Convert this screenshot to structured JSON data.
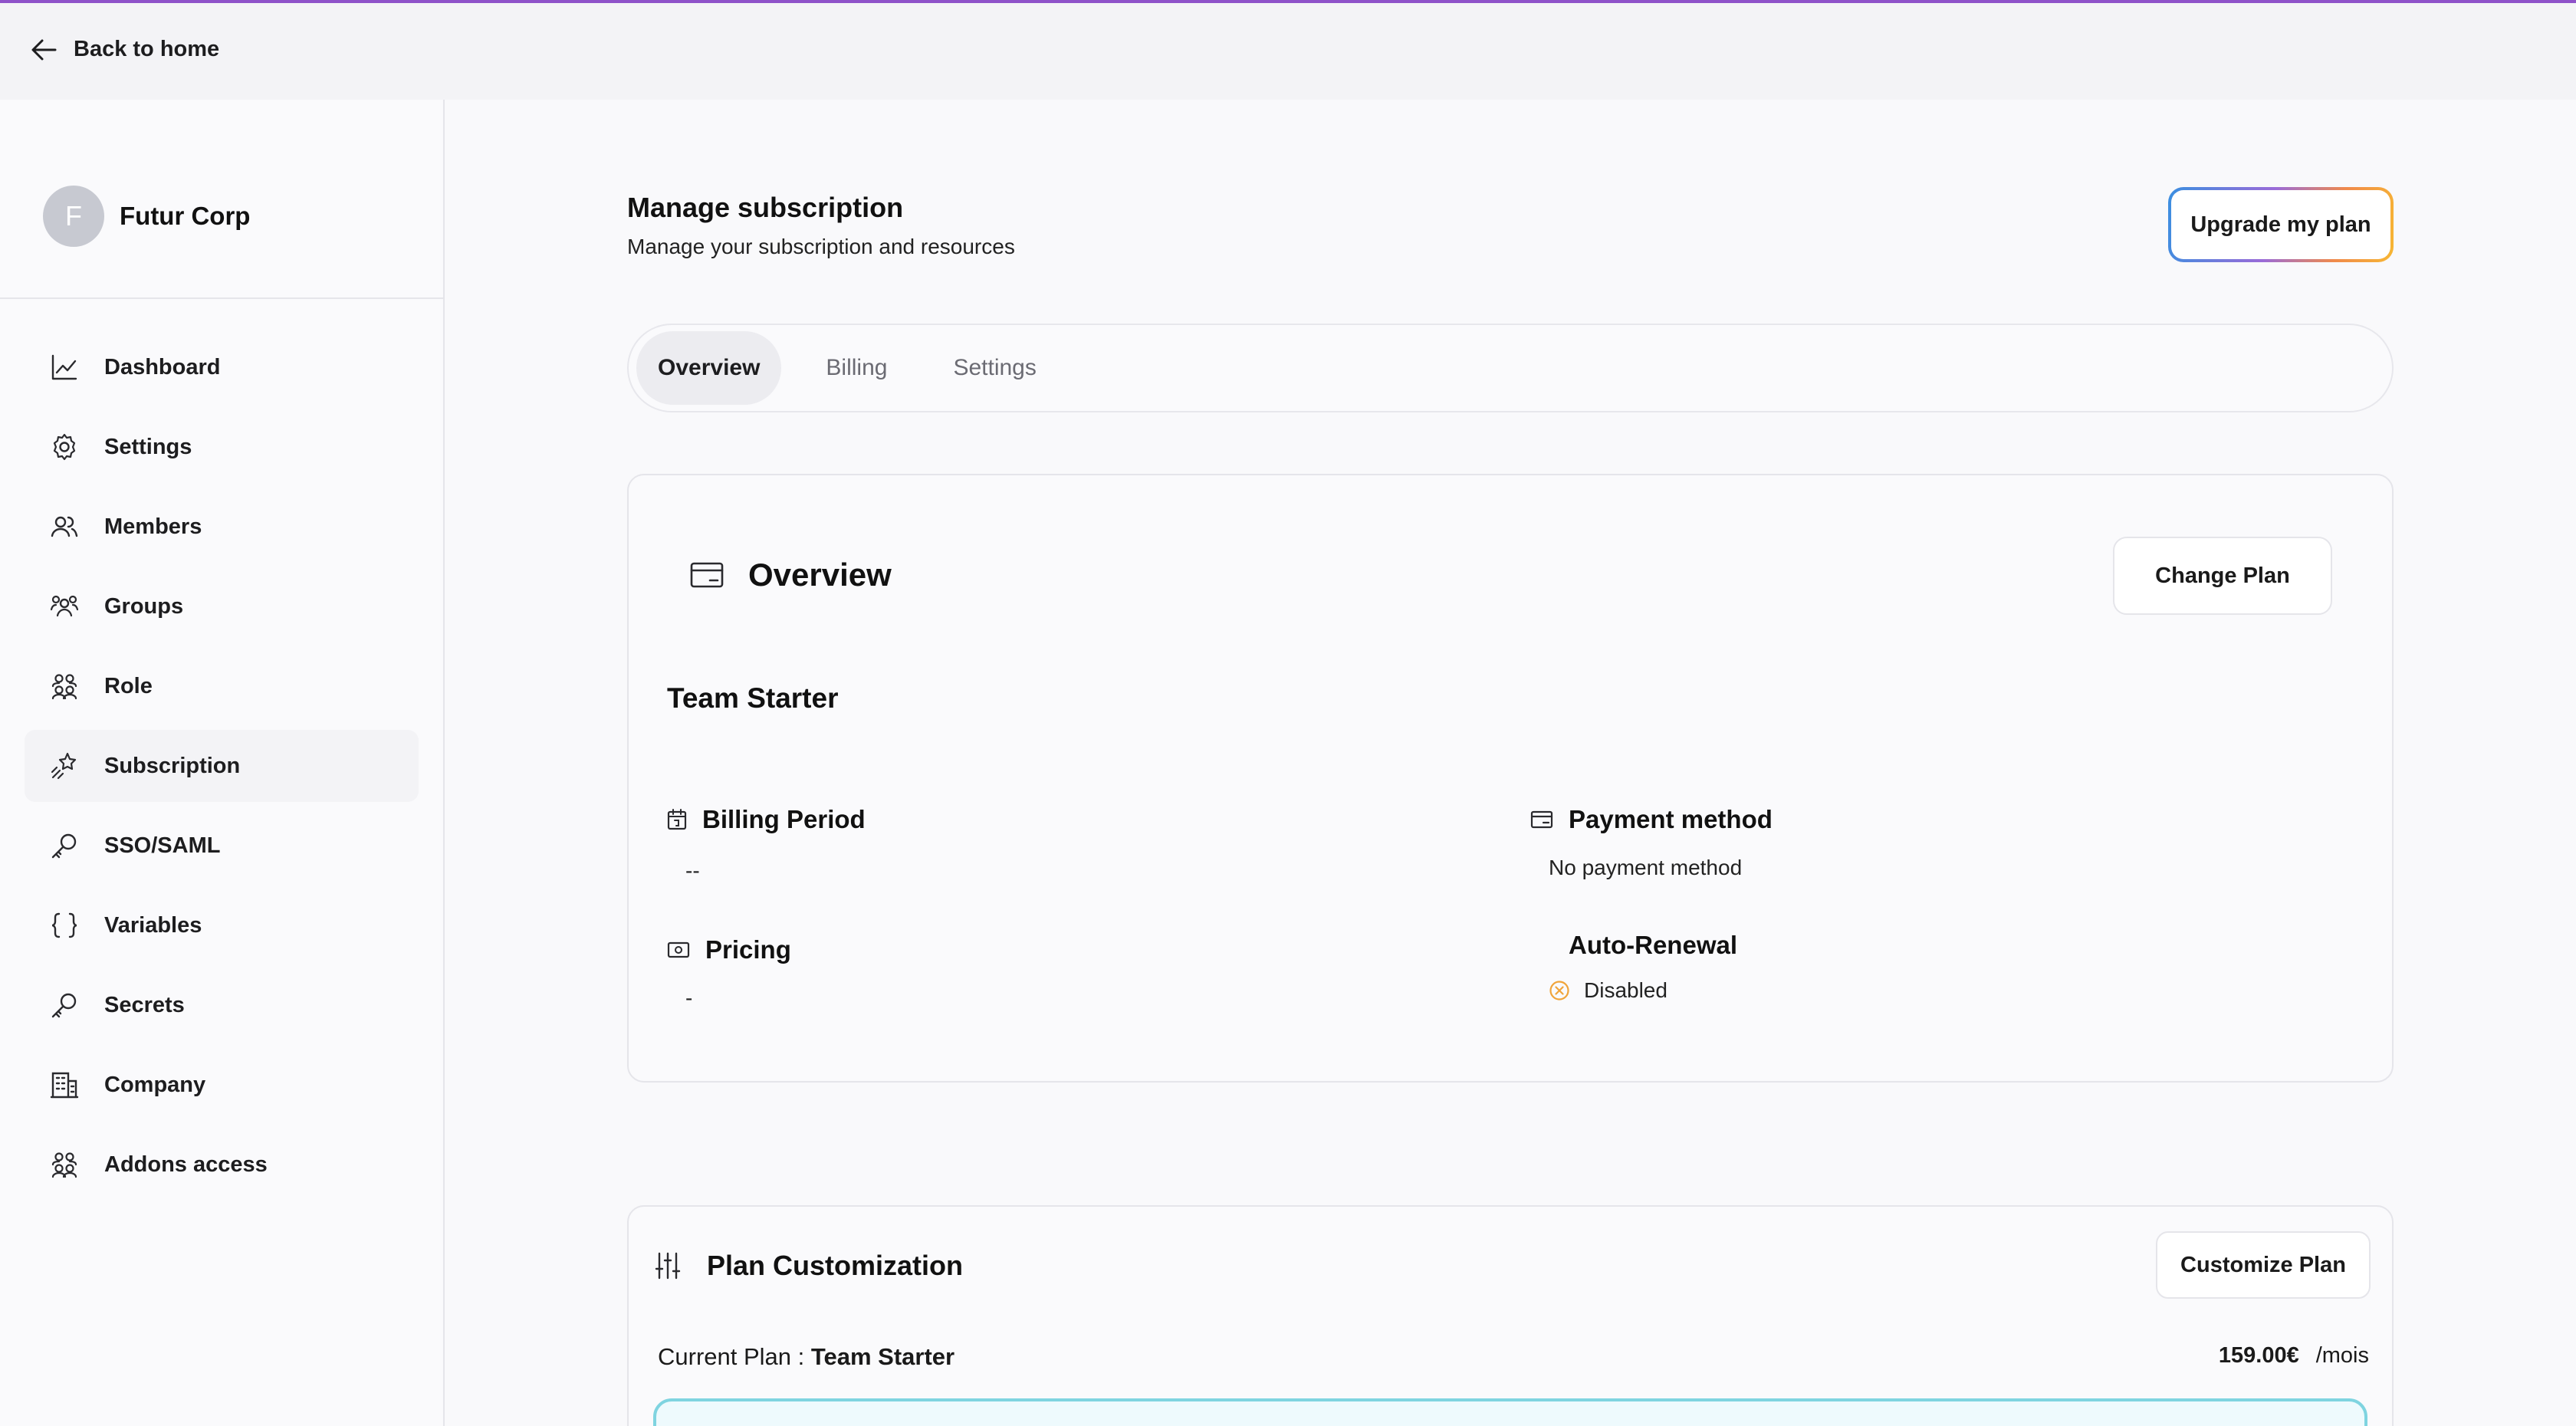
{
  "header": {
    "back_label": "Back to home"
  },
  "org": {
    "initial": "F",
    "name": "Futur Corp"
  },
  "sidebar": {
    "items": [
      {
        "label": "Dashboard",
        "icon": "chart-line-icon"
      },
      {
        "label": "Settings",
        "icon": "gear-icon"
      },
      {
        "label": "Members",
        "icon": "users-icon"
      },
      {
        "label": "Groups",
        "icon": "group-icon"
      },
      {
        "label": "Role",
        "icon": "role-icon"
      },
      {
        "label": "Subscription",
        "icon": "sparkle-pin-icon",
        "active": true
      },
      {
        "label": "SSO/SAML",
        "icon": "key-icon"
      },
      {
        "label": "Variables",
        "icon": "braces-icon"
      },
      {
        "label": "Secrets",
        "icon": "key-icon"
      },
      {
        "label": "Company",
        "icon": "building-icon"
      },
      {
        "label": "Addons access",
        "icon": "addons-icon"
      }
    ]
  },
  "page": {
    "title": "Manage subscription",
    "subtitle": "Manage your subscription and resources",
    "upgrade_label": "Upgrade my plan"
  },
  "tabs": [
    {
      "label": "Overview",
      "active": true
    },
    {
      "label": "Billing"
    },
    {
      "label": "Settings"
    }
  ],
  "overview": {
    "title": "Overview",
    "change_plan_label": "Change Plan",
    "plan_name": "Team Starter",
    "billing_period_label": "Billing Period",
    "billing_period_value": "--",
    "pricing_label": "Pricing",
    "pricing_value": "-",
    "payment_method_label": "Payment method",
    "payment_method_value": "No payment method",
    "auto_renewal_label": "Auto-Renewal",
    "auto_renewal_value": "Disabled"
  },
  "customization": {
    "title": "Plan Customization",
    "button_label": "Customize Plan",
    "current_plan_label": "Current Plan :",
    "current_plan_value": "Team Starter",
    "price": "159.00€",
    "period": "/mois"
  },
  "colors": {
    "accent_purple": "#8e52c9",
    "disabled_orange": "#f0a43a",
    "teal_border": "#7fd4e0"
  }
}
